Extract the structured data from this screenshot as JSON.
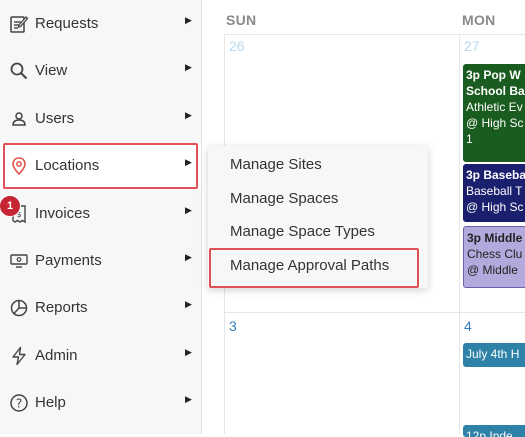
{
  "sidebar": {
    "items": [
      {
        "label": "Requests",
        "icon": "requests-icon"
      },
      {
        "label": "View",
        "icon": "search-icon"
      },
      {
        "label": "Users",
        "icon": "users-icon"
      },
      {
        "label": "Locations",
        "icon": "location-pin-icon"
      },
      {
        "label": "Invoices",
        "icon": "invoice-icon"
      },
      {
        "label": "Payments",
        "icon": "payments-icon"
      },
      {
        "label": "Reports",
        "icon": "reports-icon"
      },
      {
        "label": "Admin",
        "icon": "admin-icon"
      },
      {
        "label": "Help",
        "icon": "help-icon"
      }
    ],
    "invoices_badge": "1"
  },
  "locations_menu": {
    "items": [
      "Manage Sites",
      "Manage Spaces",
      "Manage Space Types",
      "Manage Approval Paths"
    ]
  },
  "calendar": {
    "day_headers": [
      "SUN",
      "MON"
    ],
    "week1": {
      "sun": "26",
      "mon": "27"
    },
    "week2": {
      "sun": "3",
      "mon": "4"
    },
    "events": [
      {
        "title": "3p Pop W",
        "title2": "School Ba",
        "line1": "Athletic Ev",
        "line2": "@ High Sc",
        "line3": "1"
      },
      {
        "title": "3p Baseba",
        "line1": "Baseball T",
        "line2": "@ High Sc"
      },
      {
        "title": "3p Middle",
        "line1": "Chess Clu",
        "line2": "@ Middle"
      },
      {
        "title": "July 4th H"
      },
      {
        "title": "12p Inde"
      }
    ]
  },
  "colors": {
    "highlight": "#e05056",
    "event_green": "#1a5c1f",
    "event_navy": "#1a1f6e",
    "event_lavender": "#b4a9dc",
    "event_teal": "#2e82a8"
  }
}
